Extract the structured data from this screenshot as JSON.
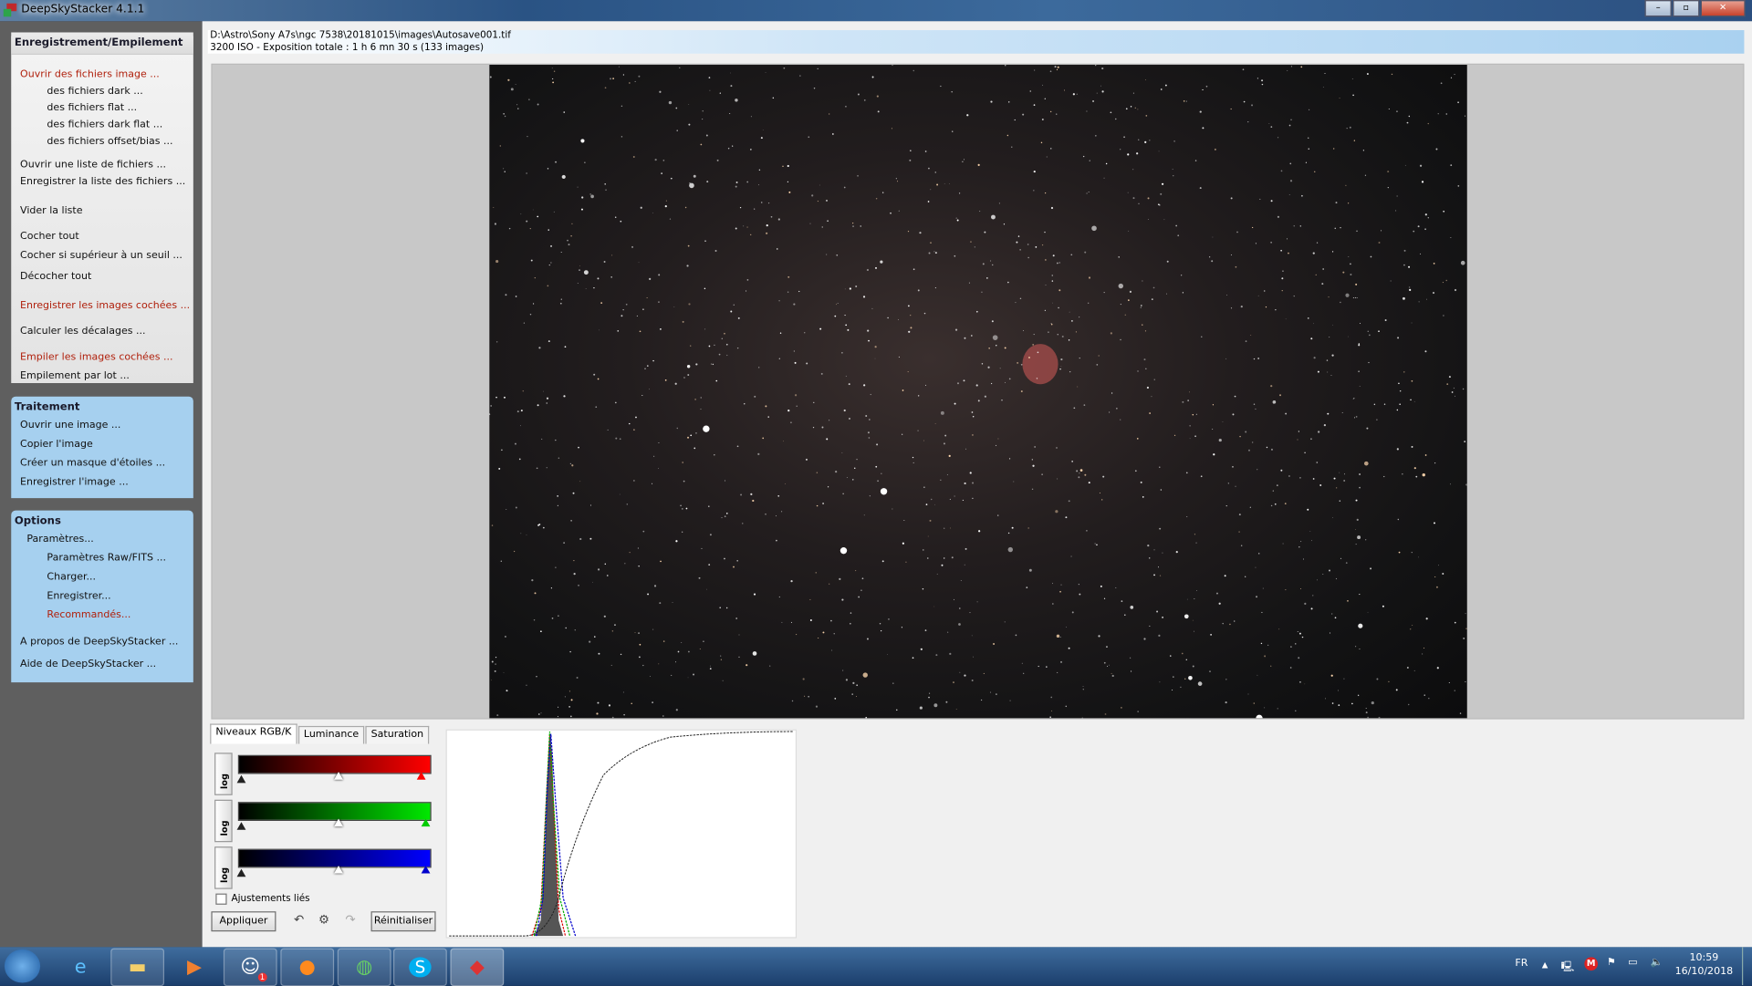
{
  "window": {
    "title": "DeepSkyStacker 4.1.1",
    "controls": [
      "–",
      "▫",
      "✕"
    ]
  },
  "sidebar": {
    "registering": {
      "title": "Enregistrement/Empilement",
      "items": [
        {
          "label": "Ouvrir des fichiers image ...",
          "red": true
        },
        {
          "label": "des fichiers dark ..."
        },
        {
          "label": "des fichiers flat ..."
        },
        {
          "label": "des fichiers dark flat ..."
        },
        {
          "label": "des fichiers offset/bias ..."
        },
        {
          "label": "Ouvrir une liste de fichiers ..."
        },
        {
          "label": "Enregistrer la liste des fichiers ..."
        },
        {
          "label": "Vider la liste"
        },
        {
          "label": "Cocher tout"
        },
        {
          "label": "Cocher si supérieur à un seuil ..."
        },
        {
          "label": "Décocher tout"
        },
        {
          "label": "Enregistrer les images cochées ...",
          "red": true
        },
        {
          "label": "Calculer les décalages ..."
        },
        {
          "label": "Empiler les images cochées ...",
          "red": true
        },
        {
          "label": "Empilement par lot ..."
        }
      ]
    },
    "processing": {
      "title": "Traitement",
      "items": [
        {
          "label": "Ouvrir une image ..."
        },
        {
          "label": "Copier l'image"
        },
        {
          "label": "Créer un masque d'étoiles ..."
        },
        {
          "label": "Enregistrer l'image ..."
        }
      ]
    },
    "options": {
      "title": "Options",
      "items": [
        {
          "label": "Paramètres..."
        },
        {
          "label": "Paramètres Raw/FITS ..."
        },
        {
          "label": "Charger..."
        },
        {
          "label": "Enregistrer..."
        },
        {
          "label": "Recommandés...",
          "red": true
        },
        {
          "label": "A propos de DeepSkyStacker ..."
        },
        {
          "label": "Aide de DeepSkyStacker ..."
        }
      ]
    }
  },
  "info": {
    "path": "D:\\Astro\\Sony A7s\\ngc 7538\\20181015\\images\\Autosave001.tif",
    "details": "3200 ISO - Exposition totale : 1 h 6 mn 30 s (133 images)"
  },
  "levels": {
    "tabs": [
      "Niveaux RGB/K",
      "Luminance",
      "Saturation"
    ],
    "active_tab": "Niveaux RGB/K",
    "log_label": "log",
    "channels": [
      {
        "name": "red",
        "color": "#ff0000"
      },
      {
        "name": "green",
        "color": "#00e000"
      },
      {
        "name": "blue",
        "color": "#0000ff"
      }
    ],
    "linked_label": "Ajustements liés",
    "linked_checked": false,
    "apply_label": "Appliquer",
    "reset_label": "Réinitialiser"
  },
  "taskbar": {
    "apps": [
      "internet-explorer",
      "file-explorer",
      "media-player",
      "discord",
      "firefox",
      "globe-app",
      "skype",
      "deepskystacker"
    ],
    "discord_badge": "1",
    "lang": "FR",
    "time": "10:59",
    "date": "16/10/2018"
  }
}
